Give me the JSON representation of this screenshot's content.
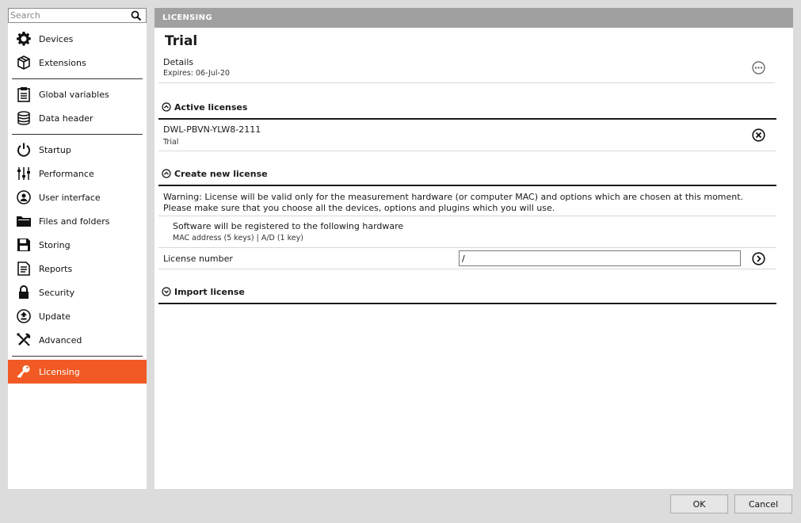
{
  "search": {
    "placeholder": "Search"
  },
  "sidebar": {
    "items": [
      {
        "label": "Devices",
        "icon": "gear-icon"
      },
      {
        "label": "Extensions",
        "icon": "cube-icon"
      },
      {
        "label": "Global variables",
        "icon": "clipboard-icon"
      },
      {
        "label": "Data header",
        "icon": "database-icon"
      },
      {
        "label": "Startup",
        "icon": "power-icon"
      },
      {
        "label": "Performance",
        "icon": "sliders-icon"
      },
      {
        "label": "User interface",
        "icon": "user-circle-icon"
      },
      {
        "label": "Files and folders",
        "icon": "folder-icon"
      },
      {
        "label": "Storing",
        "icon": "floppy-disk-icon"
      },
      {
        "label": "Reports",
        "icon": "report-icon"
      },
      {
        "label": "Security",
        "icon": "lock-icon"
      },
      {
        "label": "Update",
        "icon": "upload-circle-icon"
      },
      {
        "label": "Advanced",
        "icon": "tools-icon"
      },
      {
        "label": "Licensing",
        "icon": "key-icon",
        "active": true
      }
    ]
  },
  "header": {
    "title": "LICENSING"
  },
  "main": {
    "title": "Trial",
    "details": {
      "label": "Details",
      "expires": "Expires: 06-Jul-20"
    },
    "active_licenses": {
      "title": "Active licenses",
      "items": [
        {
          "key": "DWL-PBVN-YLW8-2111",
          "type": "Trial"
        }
      ]
    },
    "create": {
      "title": "Create new license",
      "warning": "Warning: License will be valid only for the measurement hardware (or computer MAC) and options which are chosen at this moment. Please make sure that you choose all the devices, options and plugins which you will use.",
      "hw_title": "Software will be registered to the following hardware",
      "hw_detail": "MAC address (5 keys) | A/D (1 key)",
      "license_number_label": "License number",
      "license_number_value": "/"
    },
    "import": {
      "title": "Import license"
    }
  },
  "footer": {
    "ok": "OK",
    "cancel": "Cancel"
  },
  "colors": {
    "accent": "#f15a24",
    "header_bg": "#a0a0a0",
    "window_bg": "#dcdcdc"
  }
}
